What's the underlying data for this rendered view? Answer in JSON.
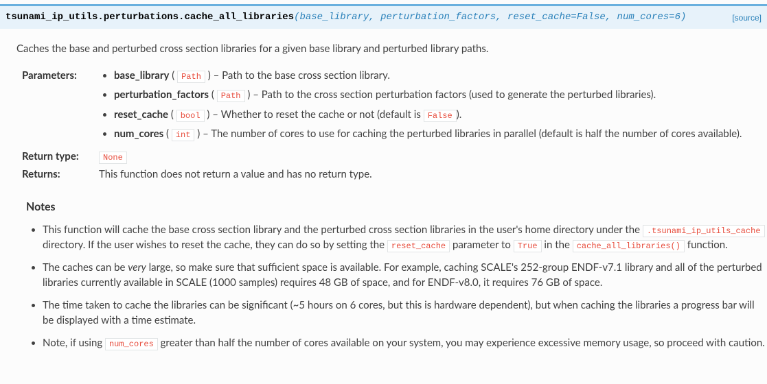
{
  "signature": {
    "qualname": "tsunami_ip_utils.perturbations.cache_all_libraries",
    "params_raw": "(base_library, perturbation_factors, reset_cache=False, num_cores=6)",
    "source_label": "[source]"
  },
  "intro": "Caches the base and perturbed cross section libraries for a given base library and perturbed library paths.",
  "labels": {
    "parameters": "Parameters:",
    "return_type": "Return type:",
    "returns": "Returns:",
    "notes": "Notes"
  },
  "params": [
    {
      "name": "base_library",
      "type": "Path",
      "desc": " – Path to the base cross section library."
    },
    {
      "name": "perturbation_factors",
      "type": "Path",
      "desc": " – Path to the cross section perturbation factors (used to generate the perturbed libraries)."
    },
    {
      "name": "reset_cache",
      "type": "bool",
      "desc_pre": " – Whether to reset the cache or not (default is ",
      "lit": "False",
      "desc_post": ")."
    },
    {
      "name": "num_cores",
      "type": "int",
      "desc": " – The number of cores to use for caching the perturbed libraries in parallel (default is half the number of cores available)."
    }
  ],
  "return_type_value": "None",
  "returns_text": "This function does not return a value and has no return type.",
  "notes": {
    "n1_a": "This function will cache the base cross section library and the perturbed cross section libraries in the user's home directory under the ",
    "n1_lit1": ".tsunami_ip_utils_cache",
    "n1_b": " directory. If the user wishes to reset the cache, they can do so by setting the ",
    "n1_lit2": "reset_cache",
    "n1_c": " parameter to ",
    "n1_lit3": "True",
    "n1_d": " in the ",
    "n1_lit4": "cache_all_libraries()",
    "n1_e": " function.",
    "n2_a": "The caches can be ",
    "n2_em": "very",
    "n2_b": " large, so make sure that sufficient space is available. For example, caching SCALE's 252-group ENDF-v7.1 library and all of the perturbed libraries currently available in SCALE (1000 samples) requires 48 GB of space, and for ENDF-v8.0, it requires 76 GB of space.",
    "n3": "The time taken to cache the libraries can be significant (~5 hours on 6 cores, but this is hardware dependent), but when caching the libraries a progress bar will be displayed with a time estimate.",
    "n4_a": "Note, if using ",
    "n4_lit": "num_cores",
    "n4_b": " greater than half the number of cores available on your system, you may experience excessive memory usage, so proceed with caution."
  }
}
